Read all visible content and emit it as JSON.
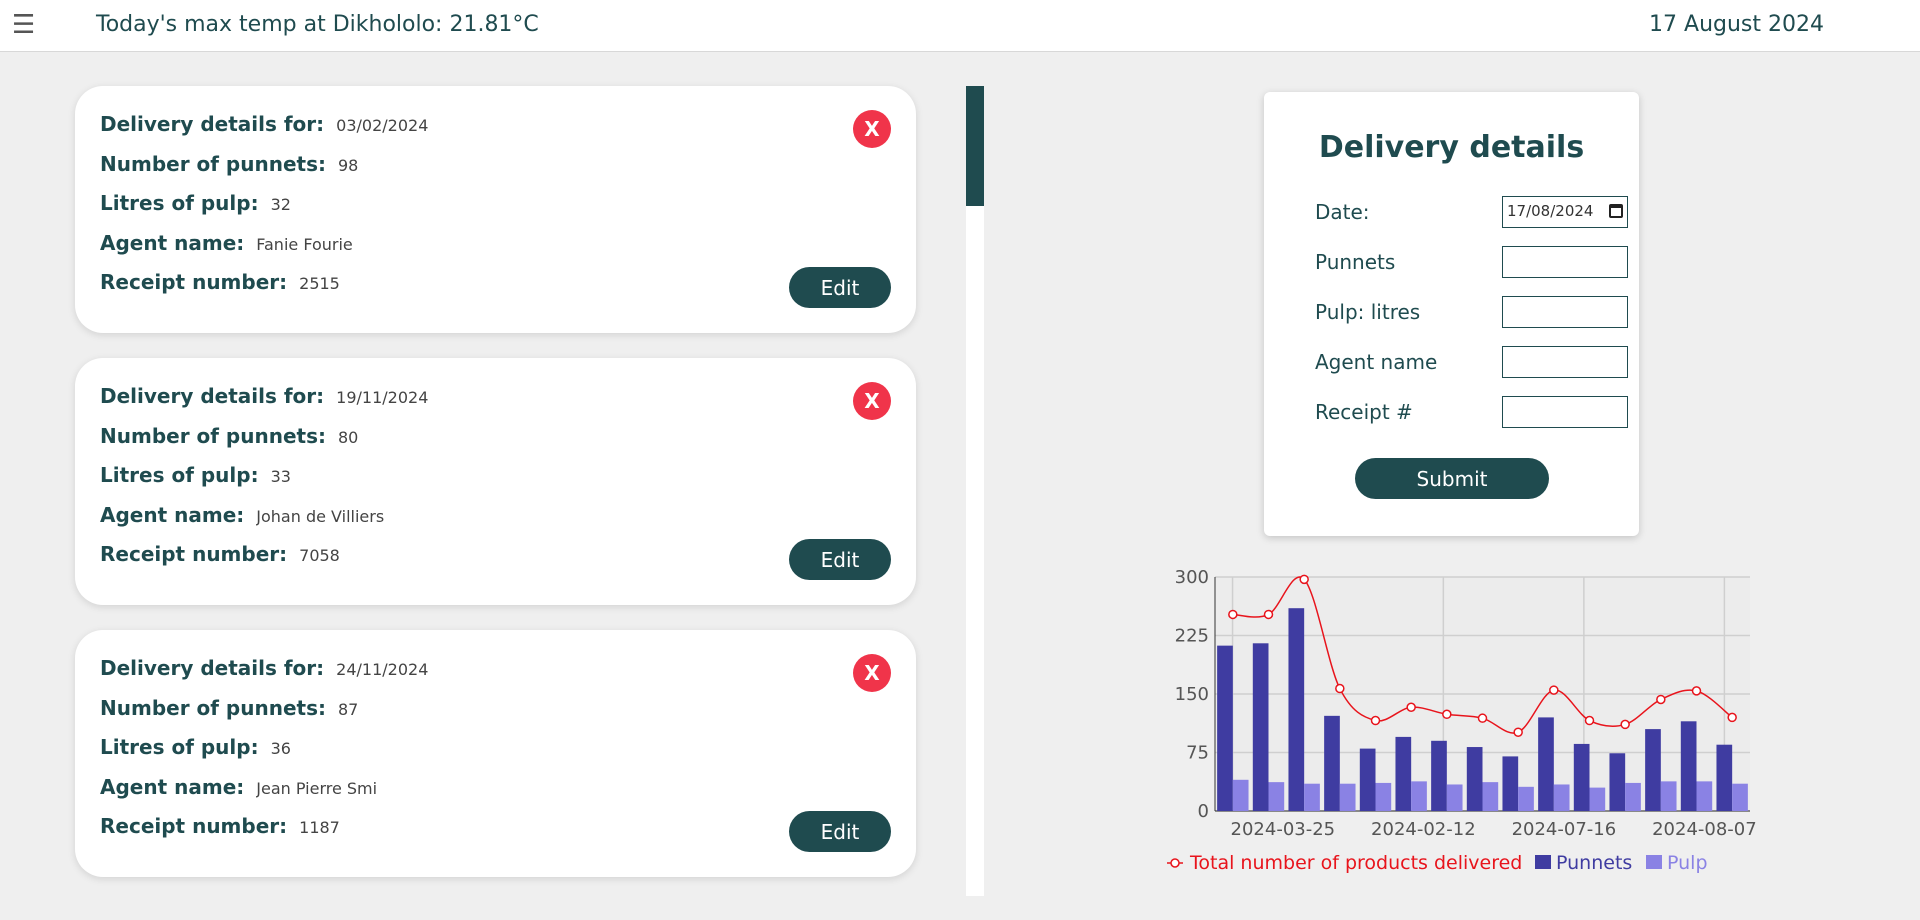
{
  "header": {
    "menu_icon": "hamburger-icon",
    "temperature": "Today's max temp at Dikhololo: 21.81°C",
    "date": "17 August 2024"
  },
  "labels": {
    "delivery_for": "Delivery details for:",
    "punnets": "Number of punnets:",
    "pulp": "Litres of pulp:",
    "agent": "Agent name:",
    "receipt": "Receipt number:",
    "delete": "X",
    "edit": "Edit"
  },
  "deliveries": [
    {
      "date": "03/02/2024",
      "punnets": "98",
      "pulp": "32",
      "agent": "Fanie Fourie",
      "receipt": "2515"
    },
    {
      "date": "19/11/2024",
      "punnets": "80",
      "pulp": "33",
      "agent": "Johan de Villiers",
      "receipt": "7058"
    },
    {
      "date": "24/11/2024",
      "punnets": "87",
      "pulp": "36",
      "agent": "Jean Pierre Smi",
      "receipt": "1187"
    }
  ],
  "scrollbar": {
    "position": 0
  },
  "form": {
    "title": "Delivery details",
    "date_label": "Date:",
    "date_value": "17/08/2024",
    "punnets_label": "Punnets",
    "pulp_label": "Pulp: litres",
    "agent_label": "Agent name",
    "receipt_label": "Receipt #",
    "submit": "Submit"
  },
  "colors": {
    "primary": "#1f4b4f",
    "delete": "#f0344a",
    "line": "#e8141c",
    "punnets": "#3f3ca1",
    "pulp": "#8a82e4"
  },
  "chart_data": {
    "type": "bar",
    "ylim": [
      0,
      300
    ],
    "yticks": [
      "0",
      "75",
      "150",
      "225",
      "300"
    ],
    "xtick_labels": [
      "2024-03-25",
      "2024-02-12",
      "2024-07-16",
      "2024-08-07"
    ],
    "grid": true,
    "legend_position": "bottom",
    "series": [
      {
        "name": "Total number of products delivered",
        "type": "line",
        "values": [
          252,
          252,
          297,
          157,
          116,
          133,
          124,
          119,
          101,
          155,
          116,
          111,
          143,
          154,
          120
        ]
      },
      {
        "name": "Punnets",
        "type": "bar",
        "values": [
          212,
          215,
          260,
          122,
          80,
          95,
          90,
          82,
          70,
          120,
          86,
          74,
          105,
          115,
          85
        ]
      },
      {
        "name": "Pulp",
        "type": "bar",
        "values": [
          40,
          37,
          35,
          35,
          36,
          38,
          34,
          37,
          31,
          34,
          30,
          36,
          38,
          38,
          35
        ]
      }
    ]
  }
}
